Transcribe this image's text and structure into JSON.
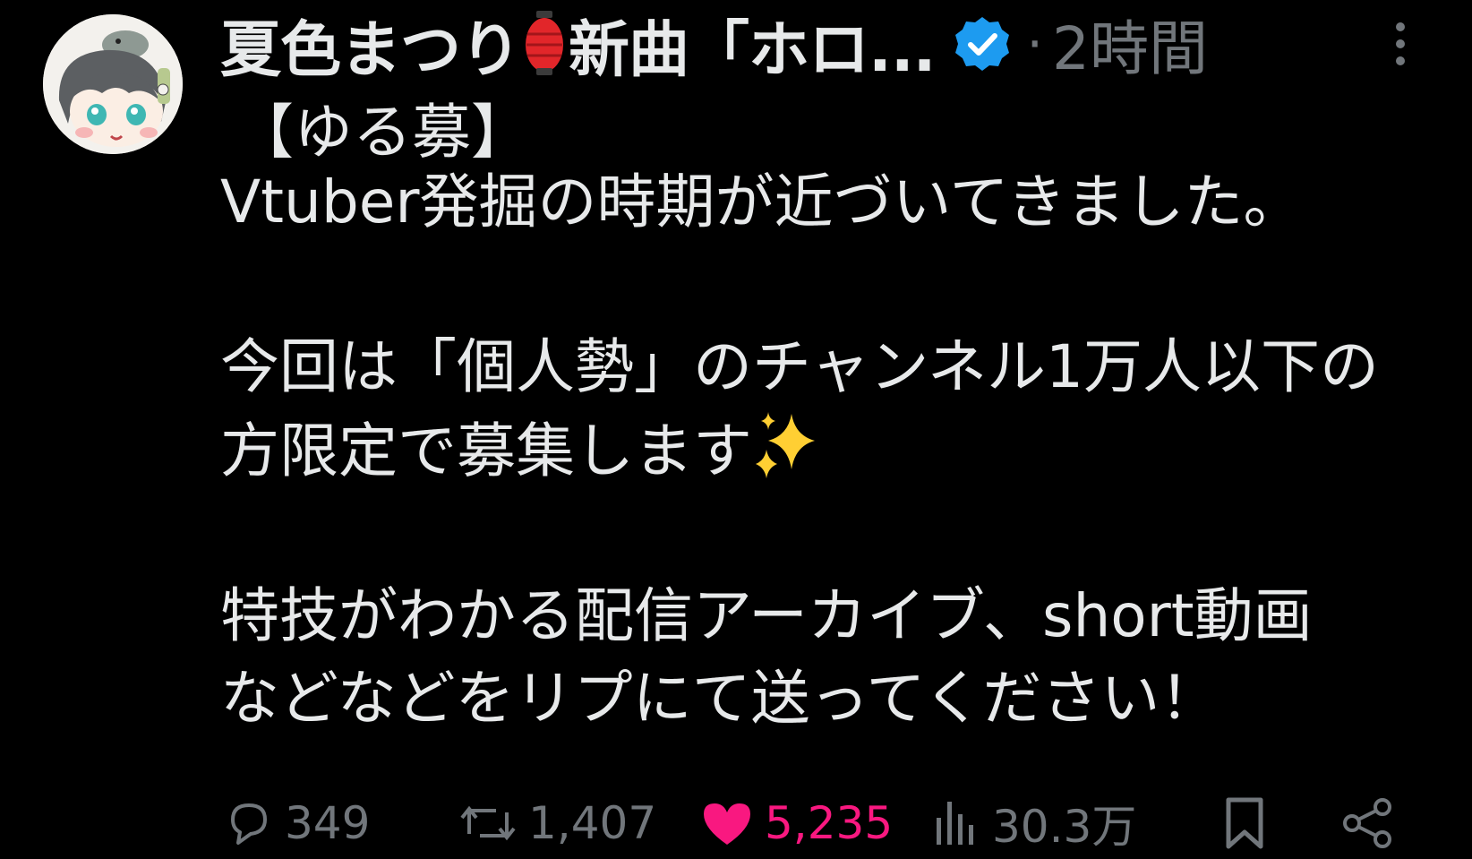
{
  "post": {
    "author": {
      "name_prefix": "夏色まつり",
      "name_suffix": "新曲「ホロ...",
      "verified": true
    },
    "separator": "·",
    "timestamp": "2時間",
    "badge": "【ゆる募】",
    "body": {
      "line1": "Vtuber発掘の時期が近づいてきました。",
      "line2": "今回は「個人勢」のチャンネル1万人以下の",
      "line3": "方限定で募集します",
      "line4": "特技がわかる配信アーカイブ、short動画",
      "line5": "などなどをリプにて送ってください！"
    },
    "actions": {
      "reply_count": "349",
      "repost_count": "1,407",
      "like_count": "5,235",
      "view_count": "30.3万"
    }
  },
  "icons": {
    "avatar": "avatar-illustration",
    "name_emoji": "lantern-icon",
    "verified": "verified-badge-icon",
    "more": "more-vertical-icon",
    "body_emoji": "sparkles-icon",
    "reply": "reply-bubble-icon",
    "repost": "repost-icon",
    "like": "heart-icon",
    "views": "views-bar-icon",
    "bookmark": "bookmark-icon",
    "share": "share-icon"
  },
  "colors": {
    "background": "#000000",
    "text": "#e7e9ea",
    "secondary": "#71767b",
    "verified": "#1d9bf0",
    "like": "#f91880"
  }
}
